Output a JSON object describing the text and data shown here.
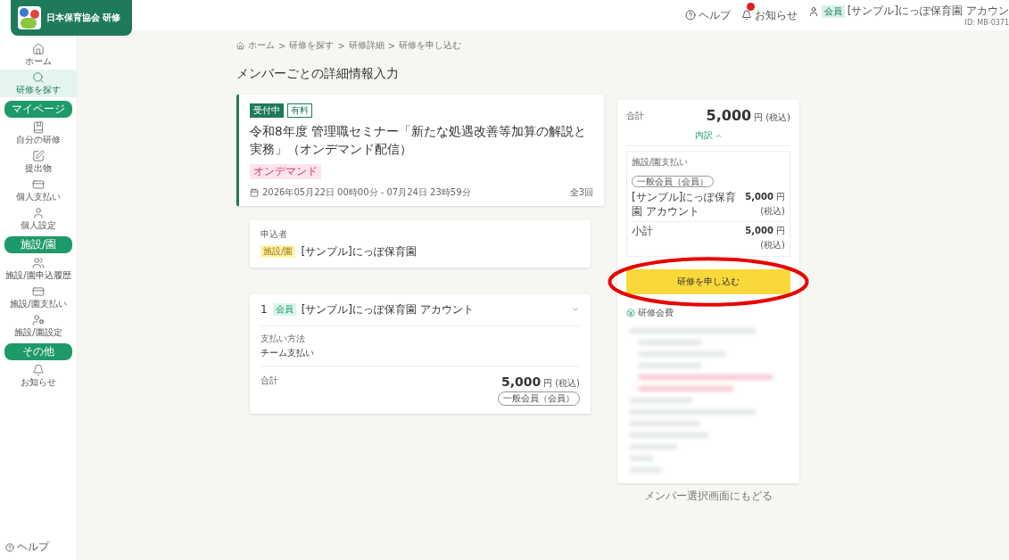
{
  "logo": {
    "text": "日本保育協会 研修"
  },
  "header": {
    "help": "ヘルプ",
    "notice": "お知らせ",
    "notice_badge": true,
    "user_tag": "会員",
    "user_name": "[サンプル]にっぽ保育園 アカウン",
    "user_id": "ID: MB-0371"
  },
  "sidebar": {
    "items": [
      {
        "kind": "item",
        "label": "ホーム",
        "selected": false
      },
      {
        "kind": "item",
        "label": "研修を探す",
        "selected": true
      },
      {
        "kind": "section",
        "label": "マイページ"
      },
      {
        "kind": "item",
        "label": "自分の研修",
        "selected": false
      },
      {
        "kind": "item",
        "label": "提出物",
        "selected": false
      },
      {
        "kind": "item",
        "label": "個人支払い",
        "selected": false
      },
      {
        "kind": "item",
        "label": "個人設定",
        "selected": false
      },
      {
        "kind": "section",
        "label": "施設/園"
      },
      {
        "kind": "item",
        "label": "施設/園申込履歴",
        "selected": false
      },
      {
        "kind": "item",
        "label": "施設/園支払い",
        "selected": false
      },
      {
        "kind": "item",
        "label": "施設/園設定",
        "selected": false
      },
      {
        "kind": "section",
        "label": "その他"
      },
      {
        "kind": "item",
        "label": "お知らせ",
        "selected": false
      }
    ],
    "help": "ヘルプ"
  },
  "breadcrumb": {
    "separator": ">",
    "items": [
      "ホーム",
      "研修を探す",
      "研修詳細",
      "研修を申し込む"
    ]
  },
  "page_title": "メンバーごとの詳細情報入力",
  "course": {
    "status": "受付中",
    "tag": "有料",
    "title": "令和8年度 管理職セミナー「新たな処遇改善等加算の解説と実務」（オンデマンド配信）",
    "format": "オンデマンド",
    "period": "2026年05月22日 00時00分 - 07月24日 23時59分",
    "sessions": "全3回"
  },
  "applicant": {
    "label": "申込者",
    "tag": "施設/園",
    "name": "[サンプル]にっぽ保育園"
  },
  "members": [
    {
      "number": "1",
      "tag": "会員",
      "name": "[サンプル]にっぽ保育園 アカウント",
      "expanded": true,
      "payment_label": "支払い方法",
      "payment": "チーム支払い",
      "total_label": "合計",
      "amount": "5,000",
      "unit": "円",
      "tax": "(税込)",
      "fee_tag": "一般会員（会員）"
    }
  ],
  "summary": {
    "total_label": "合計",
    "amount": "5,000",
    "unit": "円",
    "tax": "(税込)",
    "breakdown": "内訳",
    "breakdown_expanded": true,
    "payer": "施設/園支払い",
    "fee_tag": "一般会員（会員）",
    "lines": [
      {
        "name": "[サンプル]にっぽ保育園 アカウント",
        "amount": "5,000",
        "unit": "円",
        "tax": "(税込)"
      }
    ],
    "subtotal_label": "小計",
    "subtotal": "5,000",
    "subtotal_unit": "円",
    "subtotal_tax": "(税込)",
    "apply_button": "研修を申し込む",
    "fee_note": "研修会費"
  },
  "back_link": "メンバー選択画面にもどる"
}
